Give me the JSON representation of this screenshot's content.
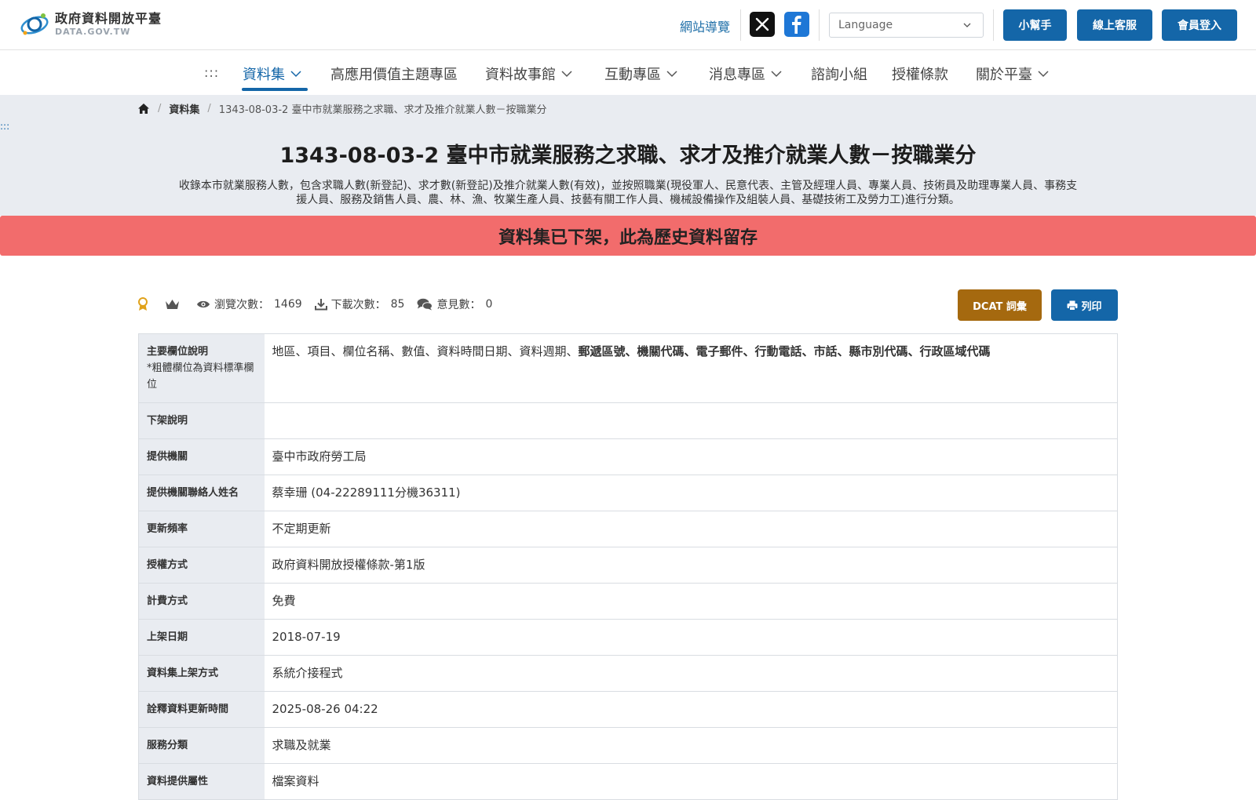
{
  "header": {
    "logo_title": "政府資料開放平臺",
    "logo_sub": "DATA.GOV.TW",
    "sitemap": "網站導覽",
    "language_placeholder": "Language",
    "helper_btn": "小幫手",
    "service_btn": "線上客服",
    "login_btn": "會員登入"
  },
  "nav": {
    "dots": ":::",
    "items": [
      "資料集",
      "高應用價值主題專區",
      "資料故事館",
      "互動專區",
      "消息專區",
      "諮詢小組",
      "授權條款",
      "關於平臺"
    ]
  },
  "breadcrumb": {
    "level1": "資料集",
    "current": "1343-08-03-2 臺中市就業服務之求職、求才及推介就業人數－按職業分"
  },
  "skip_dots": ":::",
  "title": "1343-08-03-2 臺中市就業服務之求職、求才及推介就業人數－按職業分",
  "description": "收錄本市就業服務人數，包含求職人數(新登記)、求才數(新登記)及推介就業人數(有效)，並按照職業(現役軍人、民意代表、主管及經理人員、專業人員、技術員及助理專業人員、事務支援人員、服務及銷售人員、農、林、漁、牧業生產人員、技藝有關工作人員、機械設備操作及組裝人員、基礎技術工及勞力工)進行分類。",
  "banner": "資料集已下架，此為歷史資料留存",
  "stats": {
    "views_label": "瀏覽次數：",
    "views": "1469",
    "downloads_label": "下載次數：",
    "downloads": "85",
    "comments_label": "意見數：",
    "comments": "0"
  },
  "buttons": {
    "dcat": "DCAT 詞彙",
    "print": "列印"
  },
  "table": {
    "main_fields_key": "主要欄位說明",
    "main_fields_note": "*粗體欄位為資料標準欄位",
    "main_fields_plain": "地區、項目、欄位名稱、數值、資料時間日期、資料週期、",
    "main_fields_bold": "郵遞區號、機關代碼、電子郵件、行動電話、市話、縣市別代碼、行政區域代碼",
    "rows": [
      {
        "key": "下架說明",
        "value": ""
      },
      {
        "key": "提供機關",
        "value": "臺中市政府勞工局"
      },
      {
        "key": "提供機關聯絡人姓名",
        "value": "蔡幸珊 (04-22289111分機36311)"
      },
      {
        "key": "更新頻率",
        "value": "不定期更新"
      },
      {
        "key": "授權方式",
        "value": "政府資料開放授權條款-第1版"
      },
      {
        "key": "計費方式",
        "value": "免費"
      },
      {
        "key": "上架日期",
        "value": "2018-07-19"
      },
      {
        "key": "資料集上架方式",
        "value": "系統介接程式"
      },
      {
        "key": "詮釋資料更新時間",
        "value": "2025-08-26 04:22"
      },
      {
        "key": "服務分類",
        "value": "求職及就業"
      },
      {
        "key": "資料提供屬性",
        "value": "檔案資料"
      }
    ]
  },
  "colors": {
    "primary": "#1466a8",
    "banner": "#f26c6c",
    "dcat": "#a5690f",
    "title_bg": "#e9ecf1"
  }
}
